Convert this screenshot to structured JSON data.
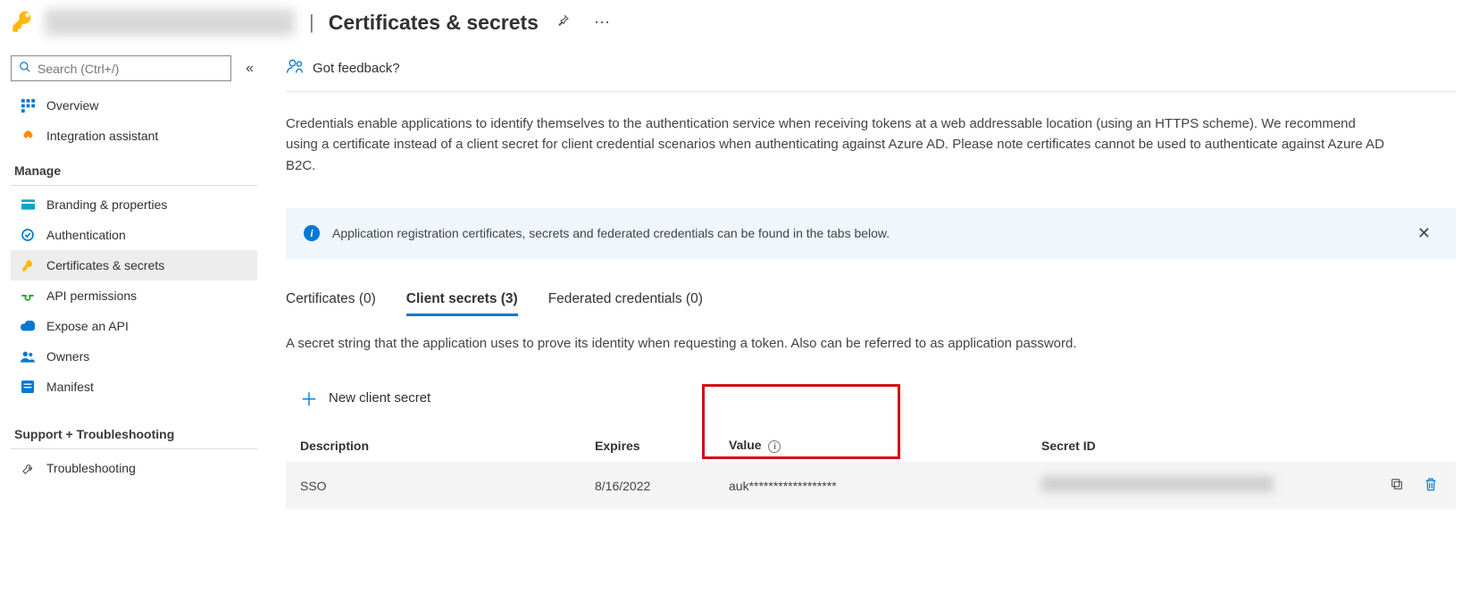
{
  "header": {
    "page_title": "Certificates & secrets"
  },
  "sidebar": {
    "search_placeholder": "Search (Ctrl+/)",
    "top": [
      {
        "label": "Overview"
      },
      {
        "label": "Integration assistant"
      }
    ],
    "manage_heading": "Manage",
    "manage": [
      {
        "label": "Branding & properties"
      },
      {
        "label": "Authentication"
      },
      {
        "label": "Certificates & secrets"
      },
      {
        "label": "API permissions"
      },
      {
        "label": "Expose an API"
      },
      {
        "label": "Owners"
      },
      {
        "label": "Manifest"
      }
    ],
    "support_heading": "Support + Troubleshooting",
    "support": [
      {
        "label": "Troubleshooting"
      }
    ]
  },
  "main": {
    "feedback_label": "Got feedback?",
    "description": "Credentials enable applications to identify themselves to the authentication service when receiving tokens at a web addressable location (using an HTTPS scheme). We recommend using a certificate instead of a client secret for client credential scenarios when authenticating against Azure AD. Please note certificates cannot be used to authenticate against Azure AD B2C.",
    "info_banner": "Application registration certificates, secrets and federated credentials can be found in the tabs below.",
    "tabs": {
      "certificates": "Certificates (0)",
      "client_secrets": "Client secrets (3)",
      "federated": "Federated credentials (0)"
    },
    "tab_description": "A secret string that the application uses to prove its identity when requesting a token. Also can be referred to as application password.",
    "new_secret_label": "New client secret",
    "columns": {
      "description": "Description",
      "expires": "Expires",
      "value": "Value",
      "secret_id": "Secret ID"
    },
    "rows": [
      {
        "description": "SSO",
        "expires": "8/16/2022",
        "value": "auk******************"
      }
    ]
  }
}
